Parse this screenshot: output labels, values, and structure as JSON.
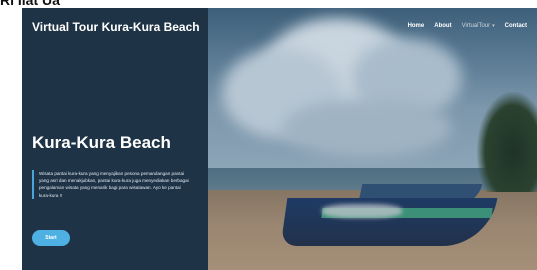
{
  "top_caption": "Ri Iiat Ua",
  "navbar": {
    "brand": "Virtual Tour Kura-Kura Beach",
    "items": [
      {
        "label": "Home"
      },
      {
        "label": "About"
      },
      {
        "label": "VirtualTour"
      },
      {
        "label": "Contact"
      }
    ],
    "dropdown_icon": "chevron-down-icon"
  },
  "hero": {
    "title": "Kura-Kura Beach",
    "description": "Wisata pantai kura-kura yang menyajikan pesona pemandangan pantai yang asri dan menakjubkan, pantai kura-kura juga menyediakan berbagai pengalaman wisata yang menarik bagi para wisatawan. Ayo ke pantai kura-kura !!",
    "start_label": "Start"
  },
  "colors": {
    "panel": "#1f3346",
    "accent": "#4fb0e3",
    "text": "#ffffff"
  }
}
